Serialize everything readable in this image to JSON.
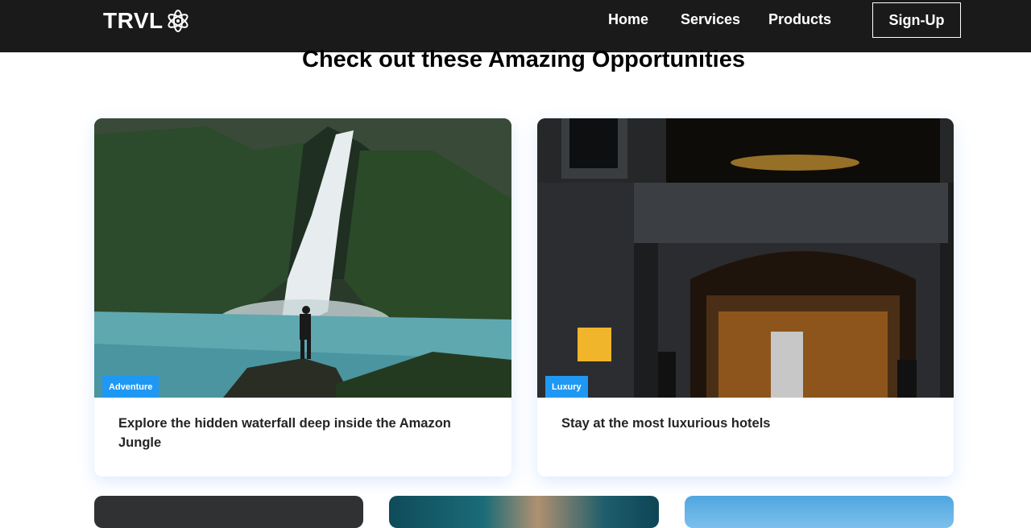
{
  "brand": {
    "name": "TRVL",
    "logo_icon": "atom-icon"
  },
  "nav": {
    "home": "Home",
    "services": "Services",
    "products": "Products",
    "signup": "Sign-Up"
  },
  "section": {
    "heading": "Check out these Amazing Opportunities"
  },
  "cards": [
    {
      "badge": "Adventure",
      "title": "Explore the hidden waterfall deep inside the Amazon Jungle"
    },
    {
      "badge": "Luxury",
      "title": "Stay at the most luxurious hotels"
    }
  ],
  "colors": {
    "navbar": "#1b1a1a",
    "badge": "#1f98f4",
    "text": "#242424"
  }
}
